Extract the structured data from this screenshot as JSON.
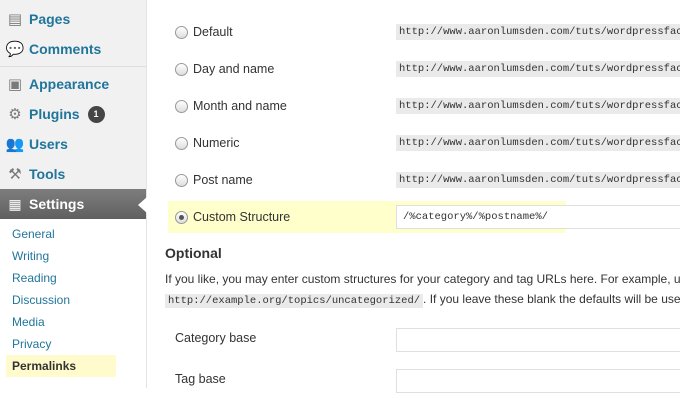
{
  "sidebar": {
    "menu": [
      {
        "id": "pages",
        "label": "Pages",
        "icon": "pages-icon"
      },
      {
        "id": "comments",
        "label": "Comments",
        "icon": "comments-icon"
      },
      {
        "id": "appearance",
        "label": "Appearance",
        "icon": "appearance-icon"
      },
      {
        "id": "plugins",
        "label": "Plugins",
        "icon": "plugins-icon",
        "badge": "1"
      },
      {
        "id": "users",
        "label": "Users",
        "icon": "users-icon"
      },
      {
        "id": "tools",
        "label": "Tools",
        "icon": "tools-icon"
      },
      {
        "id": "settings",
        "label": "Settings",
        "icon": "settings-icon"
      }
    ],
    "submenu": [
      "General",
      "Writing",
      "Reading",
      "Discussion",
      "Media",
      "Privacy",
      "Permalinks"
    ]
  },
  "permalinks": {
    "options": [
      {
        "label": "Default",
        "example": "http://www.aaronlumsden.com/tuts/wordpressfaceb",
        "checked": false
      },
      {
        "label": "Day and name",
        "example": "http://www.aaronlumsden.com/tuts/wordpressfaceb",
        "checked": false
      },
      {
        "label": "Month and name",
        "example": "http://www.aaronlumsden.com/tuts/wordpressfaceb",
        "checked": false
      },
      {
        "label": "Numeric",
        "example": "http://www.aaronlumsden.com/tuts/wordpressfaceb",
        "checked": false
      },
      {
        "label": "Post name",
        "example": "http://www.aaronlumsden.com/tuts/wordpressfaceb",
        "checked": false
      },
      {
        "label": "Custom Structure",
        "value": "/%category%/%postname%/",
        "checked": true
      }
    ]
  },
  "optional": {
    "title": "Optional",
    "line1": "If you like, you may enter custom structures for your category and tag URLs here. For example, u",
    "code": "http://example.org/topics/uncategorized/",
    "line2_rest": ". If you leave these blank the defaults will be used",
    "category_label": "Category base",
    "tag_label": "Tag base"
  },
  "colors": {
    "link": "#21759b",
    "highlight": "#ffffcc"
  }
}
